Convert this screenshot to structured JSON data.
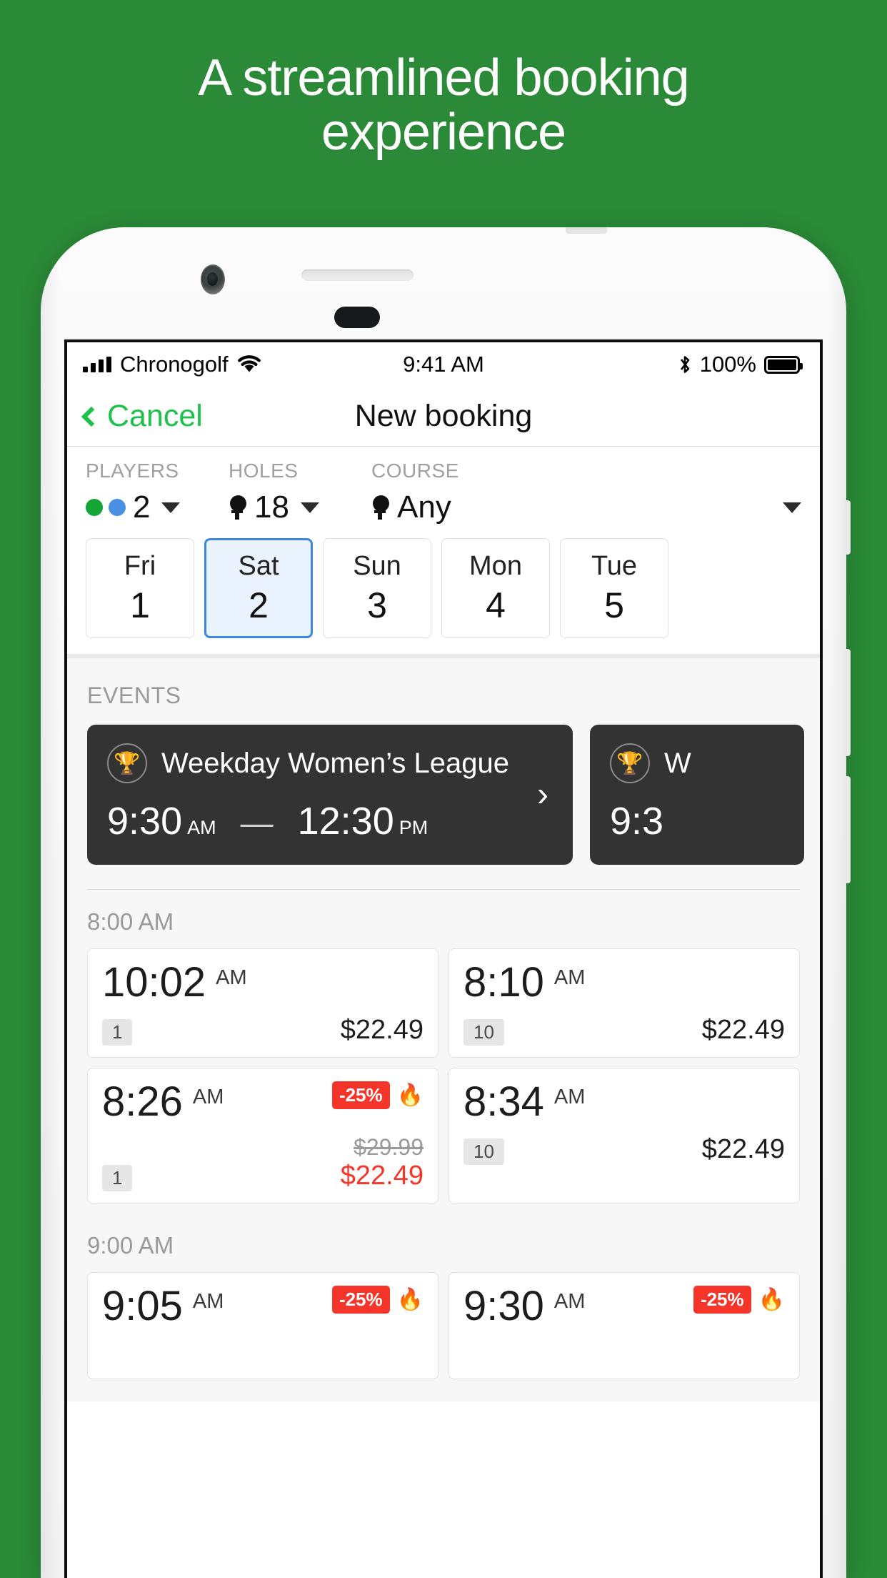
{
  "headline": "A streamlined booking experience",
  "brand_color": "#2a8a37",
  "accent_green": "#1ec24a",
  "accent_blue": "#3b87e0",
  "accent_red": "#f5342a",
  "status_bar": {
    "carrier": "Chronogolf",
    "wifi_icon": "wifi-icon",
    "signal_icon": "signal-bars-icon",
    "time": "9:41 AM",
    "bluetooth_icon": "bluetooth-icon",
    "battery_percent": "100%",
    "battery_icon": "battery-full-icon"
  },
  "nav": {
    "back_icon": "chevron-left-icon",
    "back_label": "Cancel",
    "title": "New booking"
  },
  "filters": {
    "players": {
      "label": "PLAYERS",
      "value": "2",
      "caret_icon": "chevron-down-icon"
    },
    "holes": {
      "label": "HOLES",
      "value": "18",
      "icon": "golf-tee-icon",
      "caret_icon": "chevron-down-icon"
    },
    "course": {
      "label": "COURSE",
      "value": "Any",
      "icon": "golf-tee-icon",
      "caret_icon": "chevron-down-icon"
    }
  },
  "dates": [
    {
      "dow": "Fri",
      "day": "1",
      "selected": false
    },
    {
      "dow": "Sat",
      "day": "2",
      "selected": true
    },
    {
      "dow": "Sun",
      "day": "3",
      "selected": false
    },
    {
      "dow": "Mon",
      "day": "4",
      "selected": false
    },
    {
      "dow": "Tue",
      "day": "5",
      "selected": false
    }
  ],
  "events": {
    "label": "EVENTS",
    "cards": [
      {
        "icon": "trophy-icon",
        "title": "Weekday Women’s League",
        "start_time": "9:30",
        "start_ampm": "AM",
        "dash": "—",
        "end_time": "12:30",
        "end_ampm": "PM",
        "arrow_icon": "chevron-right-icon"
      },
      {
        "icon": "trophy-icon",
        "title": "W",
        "start_time": "9:3",
        "start_ampm": "",
        "dash": "",
        "end_time": "",
        "end_ampm": "",
        "arrow_icon": ""
      }
    ]
  },
  "tee_times": [
    {
      "group_label": "8:00 AM",
      "rows": [
        [
          {
            "time": "10:02",
            "ampm": "AM",
            "holes": "1",
            "price": "$22.49",
            "discount": null,
            "old_price": null,
            "flame": false
          },
          {
            "time": "8:10",
            "ampm": "AM",
            "holes": "10",
            "price": "$22.49",
            "discount": null,
            "old_price": null,
            "flame": false
          }
        ],
        [
          {
            "time": "8:26",
            "ampm": "AM",
            "holes": "1",
            "price": "$22.49",
            "discount": "-25%",
            "old_price": "$29.99",
            "flame": true
          },
          {
            "time": "8:34",
            "ampm": "AM",
            "holes": "10",
            "price": "$22.49",
            "discount": null,
            "old_price": null,
            "flame": false
          }
        ]
      ]
    },
    {
      "group_label": "9:00 AM",
      "rows": [
        [
          {
            "time": "9:05",
            "ampm": "AM",
            "holes": "",
            "price": "",
            "discount": "-25%",
            "old_price": null,
            "flame": true
          },
          {
            "time": "9:30",
            "ampm": "AM",
            "holes": "",
            "price": "",
            "discount": "-25%",
            "old_price": null,
            "flame": true
          }
        ]
      ]
    }
  ]
}
